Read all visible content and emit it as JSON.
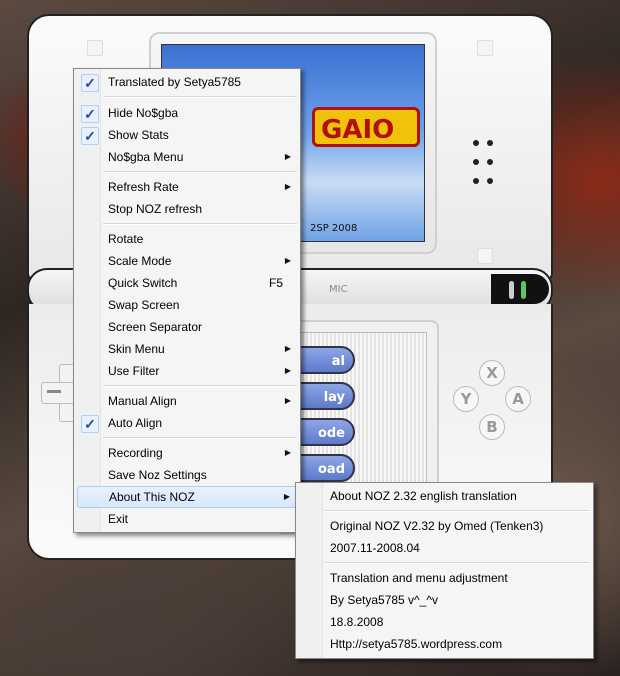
{
  "console": {
    "game_year": "2SP 2008",
    "game_logo": "GAIO",
    "mic_label": "MIC",
    "menu_buttons": [
      "al",
      "lay",
      "ode",
      "oad"
    ],
    "face_buttons": [
      "X",
      "Y",
      "A",
      "B"
    ]
  },
  "context_menu": {
    "items": [
      {
        "label": "Translated by Setya5785",
        "checked": true
      },
      {
        "label": "Hide No$gba",
        "checked": true
      },
      {
        "label": "Show Stats",
        "checked": true
      },
      {
        "label": "No$gba Menu",
        "submenu": true
      },
      {
        "label": "Refresh Rate",
        "submenu": true
      },
      {
        "label": "Stop NOZ refresh"
      },
      {
        "label": "Rotate"
      },
      {
        "label": "Scale Mode",
        "submenu": true
      },
      {
        "label": "Quick Switch",
        "shortcut": "F5"
      },
      {
        "label": "Swap Screen"
      },
      {
        "label": "Screen Separator"
      },
      {
        "label": "Skin Menu",
        "submenu": true
      },
      {
        "label": "Use Filter",
        "submenu": true
      },
      {
        "label": "Manual Align",
        "submenu": true
      },
      {
        "label": "Auto Align",
        "checked": true
      },
      {
        "label": "Recording",
        "submenu": true
      },
      {
        "label": "Save Noz Settings"
      },
      {
        "label": "About This NOZ",
        "submenu": true,
        "active": true
      },
      {
        "label": "Exit"
      }
    ],
    "check_glyph": "✓",
    "arrow_glyph": "▶"
  },
  "about_submenu": {
    "items": [
      "About NOZ 2.32 english translation",
      "Original NOZ V2.32 by Omed (Tenken3)",
      "2007.11-2008.04",
      "Translation and menu adjustment",
      "By Setya5785 v^_^v",
      "18.8.2008",
      "Http://setya5785.wordpress.com"
    ]
  }
}
